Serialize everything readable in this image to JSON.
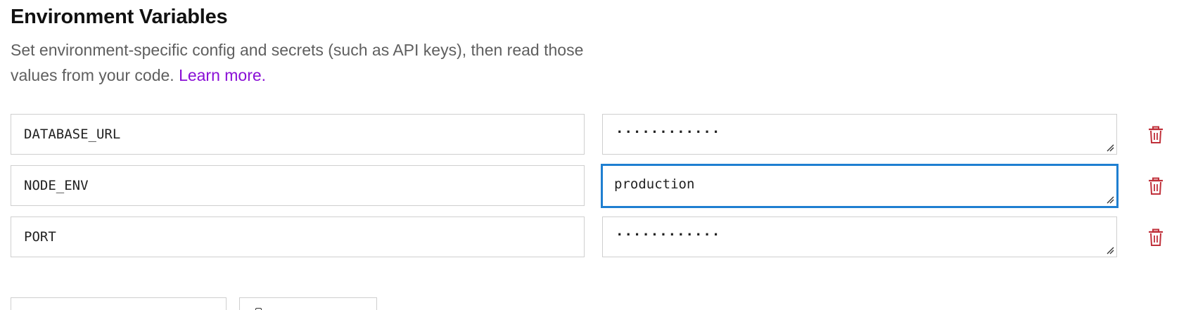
{
  "header": {
    "title": "Environment Variables",
    "description": "Set environment-specific config and secrets (such as API keys), then read those values from your code.",
    "learn_more": "Learn more."
  },
  "env_vars": [
    {
      "key": "DATABASE_URL",
      "value": "············",
      "masked": true
    },
    {
      "key": "NODE_ENV",
      "value": "production",
      "masked": false,
      "focused": true
    },
    {
      "key": "PORT",
      "value": "············",
      "masked": true
    }
  ],
  "colors": {
    "accent_focus": "#1f7fd1",
    "link": "#8a0fd6",
    "delete_icon": "#c0303a"
  },
  "icons": {
    "delete": "trash-icon",
    "resize": "resize-handle-icon"
  }
}
